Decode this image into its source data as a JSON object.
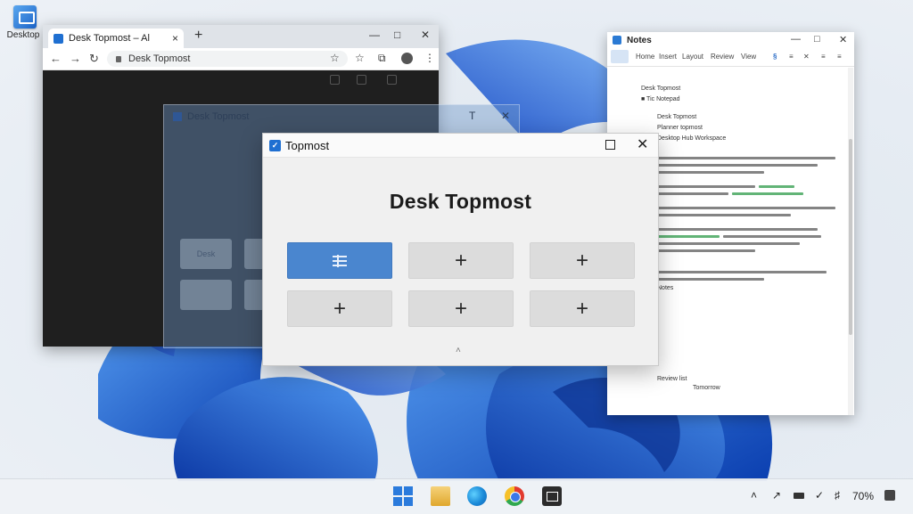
{
  "desktop": {
    "icon_label": "Desktop"
  },
  "browser": {
    "tab_title": "Desk Topmost – Al",
    "url": "Desk Topmost",
    "nav": {
      "back": "←",
      "forward": "→",
      "reload": "↻"
    },
    "new_tab": "+",
    "close_tab": "×",
    "controls": {
      "minimize": "—",
      "maximize": "□",
      "close": "✕"
    },
    "tools": {
      "star": "☆",
      "extensions": "☆",
      "split": "⧉",
      "menu": "⋮"
    }
  },
  "ghost": {
    "title": "Desk Topmost",
    "tiles": [
      "Desk",
      "",
      "",
      ""
    ],
    "controls": {
      "minimize": "T",
      "close": "✕"
    }
  },
  "notepad": {
    "title": "Notes",
    "controls": {
      "minimize": "—",
      "maximize": "□",
      "close": "✕"
    },
    "ribbon": [
      "Home",
      "Insert",
      "Layout",
      "Review",
      "View"
    ],
    "doc_lines": [
      "Desk Topmost",
      "■ Tic Notepad",
      "Desk Topmost",
      "Planner topmost",
      "Desktop Hub Workspace",
      "Notes",
      "Review list",
      "Tomorrow"
    ]
  },
  "app": {
    "title": "Topmost",
    "heading": "Desk Topmost",
    "slots": [
      {
        "state": "active",
        "label": ""
      },
      {
        "state": "empty",
        "label": "+"
      },
      {
        "state": "empty",
        "label": "+"
      },
      {
        "state": "empty",
        "label": "+"
      },
      {
        "state": "empty",
        "label": "+"
      },
      {
        "state": "empty",
        "label": "+"
      }
    ],
    "collapse": "˄",
    "accent_color": "#4a86cf"
  },
  "taskbar": {
    "apps": [
      "start-icon",
      "file-explorer-icon",
      "edge-icon",
      "chrome-icon",
      "snipping-tool-icon"
    ],
    "tray": {
      "chevron": "˄",
      "network": "↗",
      "battery_pct": "70%"
    }
  }
}
